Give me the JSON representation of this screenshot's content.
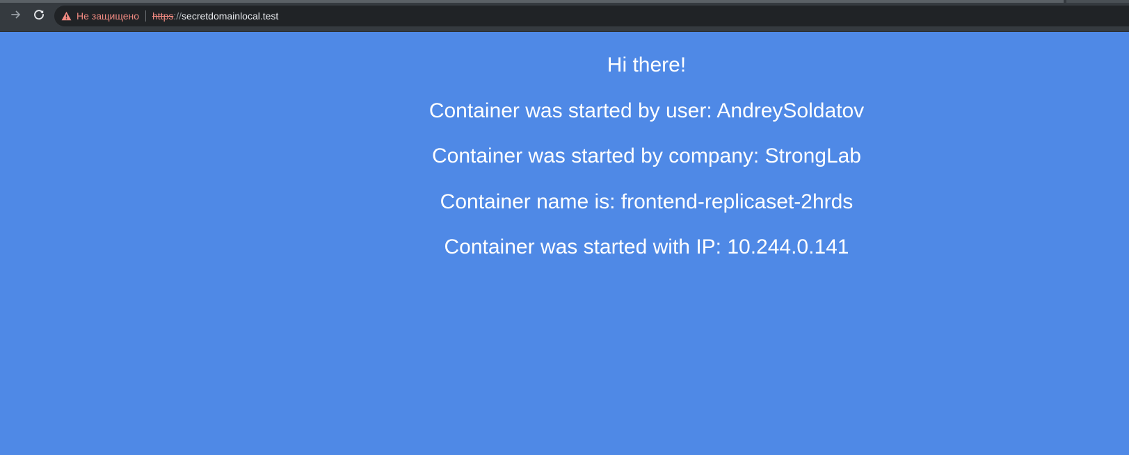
{
  "browser": {
    "security_label": "Не защищено",
    "url_scheme": "https",
    "url_separator": "://",
    "url_host": "secretdomainlocal.test",
    "icons": {
      "forward": "arrow-right-icon",
      "reload": "reload-icon",
      "warning": "warning-triangle-icon"
    },
    "colors": {
      "toolbar": "#353a3f",
      "omnibox": "#202326",
      "warning": "#f28b82"
    }
  },
  "page": {
    "background_color": "#4f89e6",
    "text_color": "#ffffff",
    "lines": [
      "Hi there!",
      "Container was started by user: AndreySoldatov",
      "Container was started by company: StrongLab",
      "Container name is: frontend-replicaset-2hrds",
      "Container was started with IP: 10.244.0.141"
    ]
  }
}
